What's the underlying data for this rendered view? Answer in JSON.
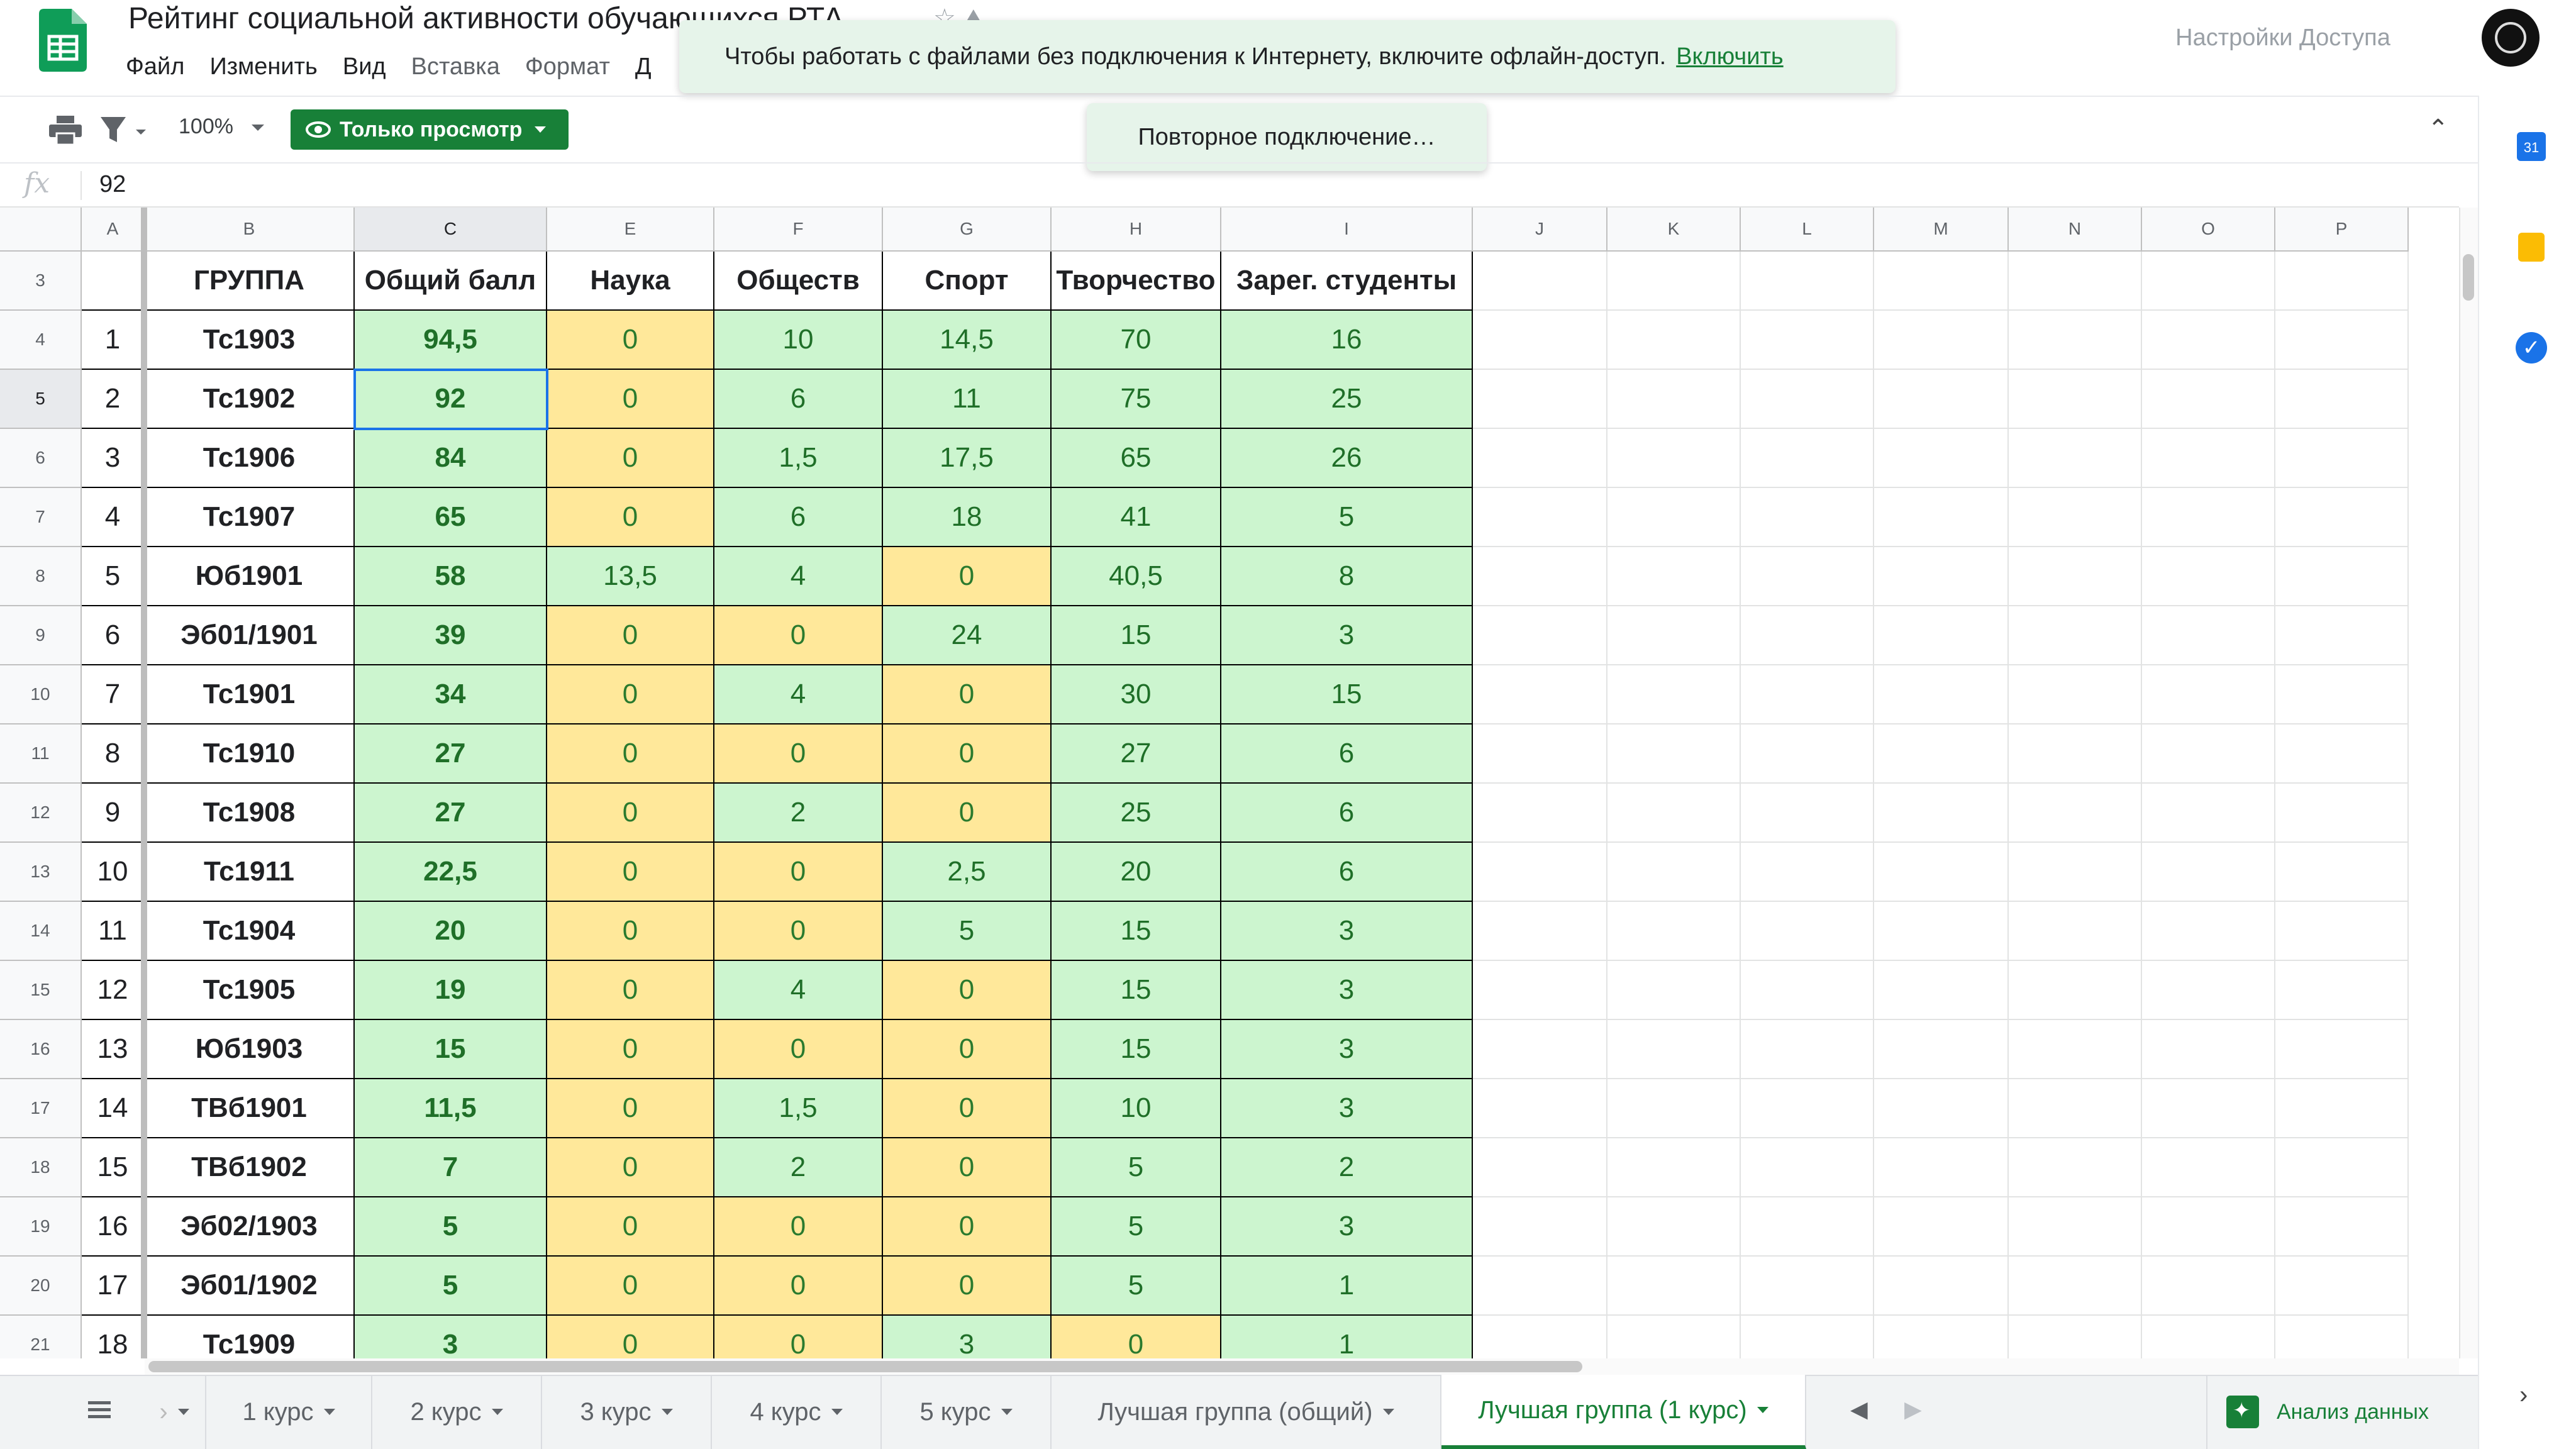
{
  "header": {
    "title": "Рейтинг социальной активности обучающихся РТА",
    "menu": [
      "Файл",
      "Изменить",
      "Вид",
      "Вставка",
      "Формат",
      "Д"
    ],
    "share_label": "Настройки Доступа"
  },
  "toast": {
    "message": "Чтобы работать с файлами без подключения к Интернету, включите офлайн-доступ.",
    "action": "Включить"
  },
  "reconnect": "Повторное подключение…",
  "toolbar": {
    "zoom": "100%",
    "view_only": "Только просмотр"
  },
  "formula_bar": {
    "value": "92"
  },
  "columns": [
    "A",
    "B",
    "C",
    "E",
    "F",
    "G",
    "H",
    "I",
    "J",
    "K",
    "L",
    "M",
    "N",
    "O",
    "P"
  ],
  "table": {
    "headers": [
      "",
      "ГРУППА",
      "Общий балл",
      "Наука",
      "Обществ",
      "Спорт",
      "Творчество",
      "Зарег. студенты"
    ],
    "row_numbers": [
      "3",
      "4",
      "5",
      "6",
      "7",
      "8",
      "9",
      "10",
      "11",
      "12",
      "13",
      "14",
      "15",
      "16",
      "17",
      "18",
      "19",
      "20",
      "21"
    ],
    "rows": [
      [
        "1",
        "Тс1903",
        "94,5",
        "0",
        "10",
        "14,5",
        "70",
        "16"
      ],
      [
        "2",
        "Тс1902",
        "92",
        "0",
        "6",
        "11",
        "75",
        "25"
      ],
      [
        "3",
        "Тс1906",
        "84",
        "0",
        "1,5",
        "17,5",
        "65",
        "26"
      ],
      [
        "4",
        "Тс1907",
        "65",
        "0",
        "6",
        "18",
        "41",
        "5"
      ],
      [
        "5",
        "Юб1901",
        "58",
        "13,5",
        "4",
        "0",
        "40,5",
        "8"
      ],
      [
        "6",
        "Эб01/1901",
        "39",
        "0",
        "0",
        "24",
        "15",
        "3"
      ],
      [
        "7",
        "Тс1901",
        "34",
        "0",
        "4",
        "0",
        "30",
        "15"
      ],
      [
        "8",
        "Тс1910",
        "27",
        "0",
        "0",
        "0",
        "27",
        "6"
      ],
      [
        "9",
        "Тс1908",
        "27",
        "0",
        "2",
        "0",
        "25",
        "6"
      ],
      [
        "10",
        "Тс1911",
        "22,5",
        "0",
        "0",
        "2,5",
        "20",
        "6"
      ],
      [
        "11",
        "Тс1904",
        "20",
        "0",
        "0",
        "5",
        "15",
        "3"
      ],
      [
        "12",
        "Тс1905",
        "19",
        "0",
        "4",
        "0",
        "15",
        "3"
      ],
      [
        "13",
        "Юб1903",
        "15",
        "0",
        "0",
        "0",
        "15",
        "3"
      ],
      [
        "14",
        "ТВб1901",
        "11,5",
        "0",
        "1,5",
        "0",
        "10",
        "3"
      ],
      [
        "15",
        "ТВб1902",
        "7",
        "0",
        "2",
        "0",
        "5",
        "2"
      ],
      [
        "16",
        "Эб02/1903",
        "5",
        "0",
        "0",
        "0",
        "5",
        "3"
      ],
      [
        "17",
        "Эб01/1902",
        "5",
        "0",
        "0",
        "0",
        "5",
        "1"
      ],
      [
        "18",
        "Тс1909",
        "3",
        "0",
        "0",
        "3",
        "0",
        "1"
      ]
    ]
  },
  "sheet_tabs": [
    "1 курс",
    "2 курс",
    "3 курс",
    "4 курс",
    "5 курс",
    "Лучшая группа (общий)",
    "Лучшая группа (1 курс)"
  ],
  "active_tab": "Лучшая группа (1 курс)",
  "explore_label": "Анализ данных",
  "calendar_day": "31",
  "colors": {
    "green_cell": "#ccf5cf",
    "yellow_cell": "#ffe89a",
    "accent": "#188038",
    "selection": "#1a73e8"
  }
}
